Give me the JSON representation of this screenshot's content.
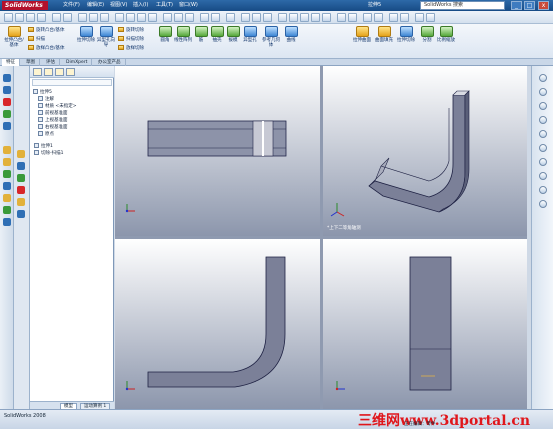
{
  "app": {
    "logo": "SolidWorks",
    "document_title": "拉伸5"
  },
  "menu": [
    "文件(F)",
    "编辑(E)",
    "视图(V)",
    "插入(I)",
    "工具(T)",
    "窗口(W)"
  ],
  "search": {
    "placeholder": "SolidWorks 搜索"
  },
  "window_buttons": {
    "minimize": "_",
    "maximize": "□",
    "close": "x"
  },
  "command_manager": {
    "large": [
      {
        "label": "拉伸凸台/基体"
      },
      {
        "label": "旋转凸台/基体"
      },
      {
        "label": "拉伸切除"
      },
      {
        "label": "异型孔向导"
      },
      {
        "label": "旋转切除"
      },
      {
        "label": "圆角"
      },
      {
        "label": "线性阵列"
      },
      {
        "label": "筋"
      },
      {
        "label": "抽壳"
      },
      {
        "label": "拔模"
      },
      {
        "label": "异型孔"
      },
      {
        "label": "参考几何体"
      },
      {
        "label": "曲线"
      }
    ],
    "small": [
      {
        "label": "扫描"
      },
      {
        "label": "放样凸台/基体"
      },
      {
        "label": "扫描切除"
      },
      {
        "label": "放样切除"
      }
    ],
    "right_group": [
      "拉伸曲面",
      "曲面填充",
      "拉伸切除",
      "分割",
      "比例缩放"
    ]
  },
  "ribbon_tabs": [
    "特征",
    "草图",
    "评估",
    "DimXpert",
    "办公室产品"
  ],
  "feature_tree": {
    "root": "拉伸5",
    "items": [
      {
        "label": "注解",
        "level": 1
      },
      {
        "label": "材质 <未指定>",
        "level": 1
      },
      {
        "label": "前视基准面",
        "level": 1
      },
      {
        "label": "上视基准面",
        "level": 1
      },
      {
        "label": "右视基准面",
        "level": 1
      },
      {
        "label": "原点",
        "level": 1
      },
      {
        "label": "拉伸1",
        "level": 1
      },
      {
        "label": "切除-扫描1",
        "level": 1
      }
    ],
    "bottom_tabs": [
      "模型",
      "运动算例 1"
    ]
  },
  "viewports": {
    "top_right_label": "*上下二等角轴测"
  },
  "status": {
    "app_name": "SolidWorks 2008",
    "editing": "正在编辑：零件",
    "watermark": "三维网www.3dportal.cn"
  }
}
